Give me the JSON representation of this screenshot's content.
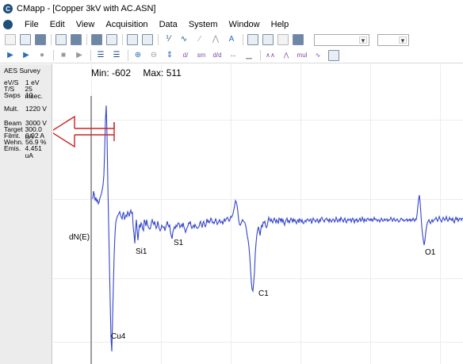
{
  "window": {
    "title": "CMapp - [Copper 3kV with AC.ASN]"
  },
  "menu": [
    "File",
    "Edit",
    "View",
    "Acquisition",
    "Data",
    "System",
    "Window",
    "Help"
  ],
  "sidepanel": {
    "title": "AES Survey",
    "params": [
      {
        "key": "eV/S",
        "value": "1 eV"
      },
      {
        "key": "T/S",
        "value": "25 msec."
      },
      {
        "key": "Swps",
        "value": "10"
      },
      {
        "key": "Mult.",
        "value": "1220 V"
      },
      {
        "key": "Beam",
        "value": "3000 V"
      },
      {
        "key": "Target",
        "value": "300.0 nA"
      },
      {
        "key": "Filmt.",
        "value": "0.92 A"
      },
      {
        "key": "Wehn.",
        "value": "56.9 %"
      },
      {
        "key": "Emis.",
        "value": "4.451 uA"
      }
    ]
  },
  "plot": {
    "min_label": "Min: -602",
    "max_label": "Max: 511",
    "ylabel": "dN(E)",
    "peaks": [
      "Si1",
      "S1",
      "C1",
      "O1",
      "Cu4"
    ],
    "trace_color": "#3344cc",
    "annotation_color": "#cc2222"
  }
}
